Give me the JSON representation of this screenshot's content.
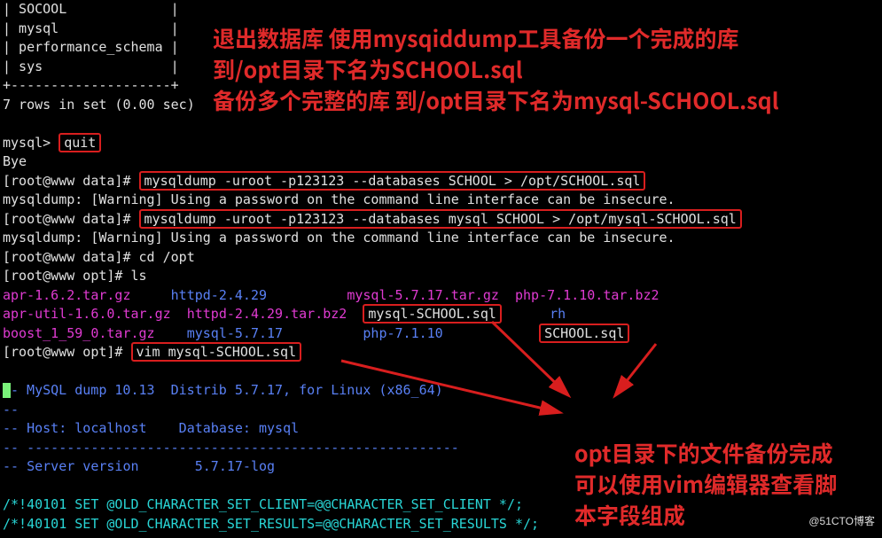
{
  "term": {
    "row0": "| SOCOOL             |",
    "row1": "| mysql              |",
    "row2": "| performance_schema |",
    "row3": "| sys                |",
    "row4": "+--------------------+",
    "row5": "7 rows in set (0.00 sec)",
    "row6_prompt": "mysql> ",
    "row6_cmd": "quit",
    "row7": "Bye",
    "row8_prompt": "[root@www data]# ",
    "row8_cmd": "mysqldump -uroot -p123123 --databases SCHOOL > /opt/SCHOOL.sql",
    "row9": "mysqldump: [Warning] Using a password on the command line interface can be insecure.",
    "row10_prompt": "[root@www data]# ",
    "row10_cmd": "mysqldump -uroot -p123123 --databases mysql SCHOOL > /opt/mysql-SCHOOL.sql",
    "row11": "mysqldump: [Warning] Using a password on the command line interface can be insecure.",
    "row12": "[root@www data]# cd /opt",
    "row13": "[root@www opt]# ls",
    "ls_r1c1": "apr-1.6.2.tar.gz",
    "ls_r1c2": "httpd-2.4.29",
    "ls_r1c3": "mysql-5.7.17.tar.gz",
    "ls_r1c4": "php-7.1.10.tar.bz2",
    "ls_r2c1": "apr-util-1.6.0.tar.gz",
    "ls_r2c2": "httpd-2.4.29.tar.bz2",
    "ls_r2c3": "mysql-SCHOOL.sql",
    "ls_r2c4": "rh",
    "ls_r3c1": "boost_1_59_0.tar.gz",
    "ls_r3c2": "mysql-5.7.17",
    "ls_r3c3": "php-7.1.10",
    "ls_r3c4": "SCHOOL.sql",
    "row17_prompt": "[root@www opt]# ",
    "row17_cmd": "vim mysql-SCHOOL.sql",
    "dump_l1": "- MySQL dump 10.13  Distrib 5.7.17, for Linux (x86_64)",
    "dump_l2": "--",
    "dump_l3": "-- Host: localhost    Database: mysql",
    "dump_l4": "-- ------------------------------------------------------",
    "dump_l5": "-- Server version       5.7.17-log",
    "dump_l6": "/*!40101 SET @OLD_CHARACTER_SET_CLIENT=@@CHARACTER_SET_CLIENT */;",
    "dump_l7": "/*!40101 SET @OLD_CHARACTER_SET_RESULTS=@@CHARACTER_SET_RESULTS */;"
  },
  "annotations": {
    "top1": "退出数据库 使用mysqiddump工具备份一个完成的库",
    "top2": "到/opt目录下名为SCHOOL.sql",
    "top3": "备份多个完整的库 到/opt目录下名为mysql-SCHOOL.sql",
    "bot1": "opt目录下的文件备份完成",
    "bot2": "可以使用vim编辑器查看脚",
    "bot3": "本字段组成"
  },
  "watermark": "@51CTO博客"
}
